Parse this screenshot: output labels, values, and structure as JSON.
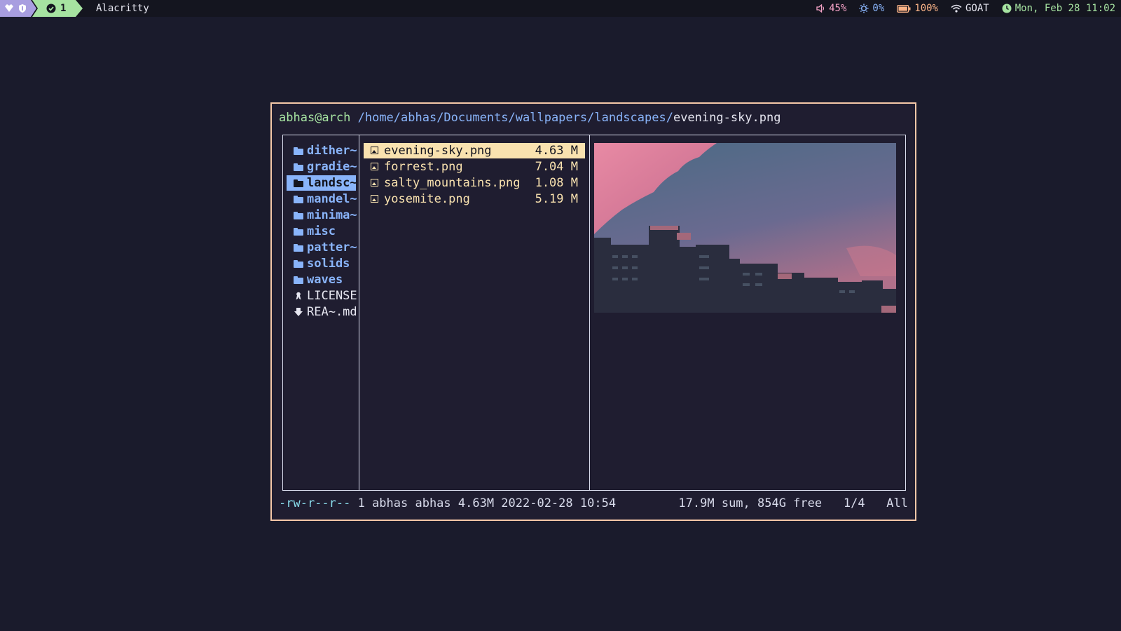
{
  "topbar": {
    "workspace": "1",
    "window_title": "Alacritty",
    "volume": "45%",
    "brightness": "0%",
    "battery": "100%",
    "network": "GOAT",
    "datetime": "Mon, Feb 28 11:02",
    "icons": [
      "heart-icon",
      "shield-icon",
      "check-circle-icon",
      "speaker-icon",
      "sun-icon",
      "battery-icon",
      "wifi-icon",
      "clock-icon"
    ]
  },
  "terminal": {
    "prompt_user": "abhas@arch",
    "path_dir": "/home/abhas/Documents/wallpapers/landscapes/",
    "path_file": "evening-sky.png",
    "parent_entries": [
      {
        "name": "dither~",
        "icon": "folder-icon"
      },
      {
        "name": "gradie~",
        "icon": "folder-icon"
      },
      {
        "name": "landsc~",
        "icon": "folder-icon",
        "selected": true
      },
      {
        "name": "mandel~",
        "icon": "folder-icon"
      },
      {
        "name": "minima~",
        "icon": "folder-icon"
      },
      {
        "name": "misc",
        "icon": "folder-icon"
      },
      {
        "name": "patter~",
        "icon": "folder-icon"
      },
      {
        "name": "solids",
        "icon": "folder-icon"
      },
      {
        "name": "waves",
        "icon": "folder-icon"
      },
      {
        "name": "LICENSE",
        "icon": "license-icon"
      },
      {
        "name": "REA~.md",
        "icon": "markdown-icon"
      }
    ],
    "files": [
      {
        "name": "evening-sky.png",
        "size": "4.63 M",
        "selected": true
      },
      {
        "name": "forrest.png",
        "size": "7.04 M"
      },
      {
        "name": "salty_mountains.png",
        "size": "1.08 M"
      },
      {
        "name": "yosemite.png",
        "size": "5.19 M"
      }
    ],
    "preview": "evening sky over city buildings",
    "status": {
      "permissions": "-rw-r--r--",
      "info": " 1 abhas abhas 4.63M 2022-02-28 10:54",
      "disk": "17.9M sum, 854G free",
      "position": "1/4",
      "scroll": "All"
    }
  },
  "colors": {
    "background": "#1a1b2c",
    "terminal_border": "#f5c8a8",
    "dir_blue": "#89b4fa",
    "host_green": "#a6e3a1",
    "selection_yellow": "#f9e2af",
    "permission_cyan": "#89dceb",
    "volume_pink": "#f5a3c7"
  }
}
